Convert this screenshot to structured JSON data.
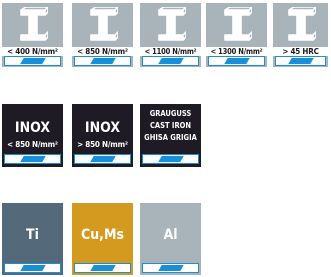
{
  "steel": [
    {
      "label": "< 400 N/mm²"
    },
    {
      "label": "< 850 N/mm²"
    },
    {
      "label": "< 1100 N/mm²"
    },
    {
      "label": "< 1300 N/mm²"
    },
    {
      "label": "> 45 HRC"
    }
  ],
  "inox": [
    {
      "title": "INOX",
      "label": "< 850 N/mm²"
    },
    {
      "title": "INOX",
      "label": "> 850 N/mm²"
    }
  ],
  "cast_iron": {
    "lines": [
      "GRAUGUSS",
      "CAST IRON",
      "GHISA GRIGIA"
    ]
  },
  "nonferrous": [
    {
      "label": "Ti",
      "color": "#546a7b"
    },
    {
      "label": "Cu,Ms",
      "color": "#d4991f"
    },
    {
      "label": "Al",
      "color": "#a9b4ba"
    }
  ],
  "colors": {
    "steel_bg": "#a9b4ba",
    "inox_bg": "#1e1b24",
    "band_blue": "#1a8fd6"
  }
}
